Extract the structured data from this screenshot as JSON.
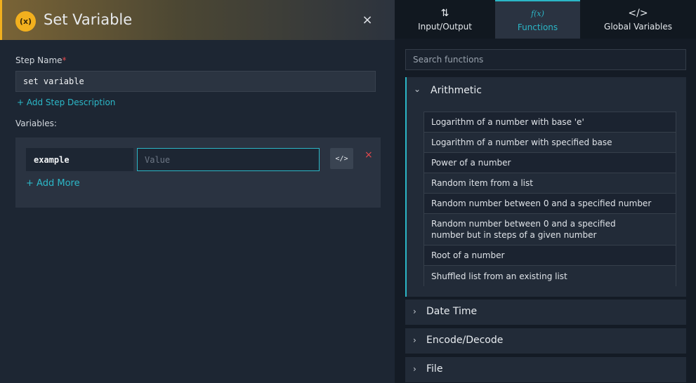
{
  "dialog": {
    "badge": "(x)",
    "title": "Set Variable",
    "close": "×",
    "step_name_label": "Step Name",
    "required_mark": "*",
    "step_name_value": "set variable",
    "add_description": "+ Add Step Description",
    "variables_label": "Variables:",
    "variables": [
      {
        "key": "example",
        "value_placeholder": "Value"
      }
    ],
    "code_button": "</>",
    "delete_button": "×",
    "add_more_plus": "+",
    "add_more": "Add More"
  },
  "right_panel": {
    "tabs": [
      {
        "icon": "⇅",
        "label": "Input/Output"
      },
      {
        "icon": "f(x)",
        "label": "Functions"
      },
      {
        "icon": "</>",
        "label": "Global Variables"
      }
    ],
    "active_tab": "Functions",
    "search_placeholder": "Search functions",
    "open_category": {
      "title": "Arithmetic",
      "chevron": "⌄",
      "functions": [
        "Logarithm of a number with base 'e'",
        "Logarithm of a number with specified base",
        "Power of a number",
        "Random item from a list",
        "Random number between 0 and a specified number",
        "Random number between 0 and a specified number but in steps of a given number",
        "Root of a number",
        "Shuffled list from an existing list"
      ]
    },
    "categories": [
      "Date Time",
      "Encode/Decode",
      "File"
    ],
    "collapsed_chevron": "›"
  },
  "colors": {
    "accent": "#2bb6c6",
    "warning": "#f2b01e",
    "danger": "#e5484d"
  }
}
